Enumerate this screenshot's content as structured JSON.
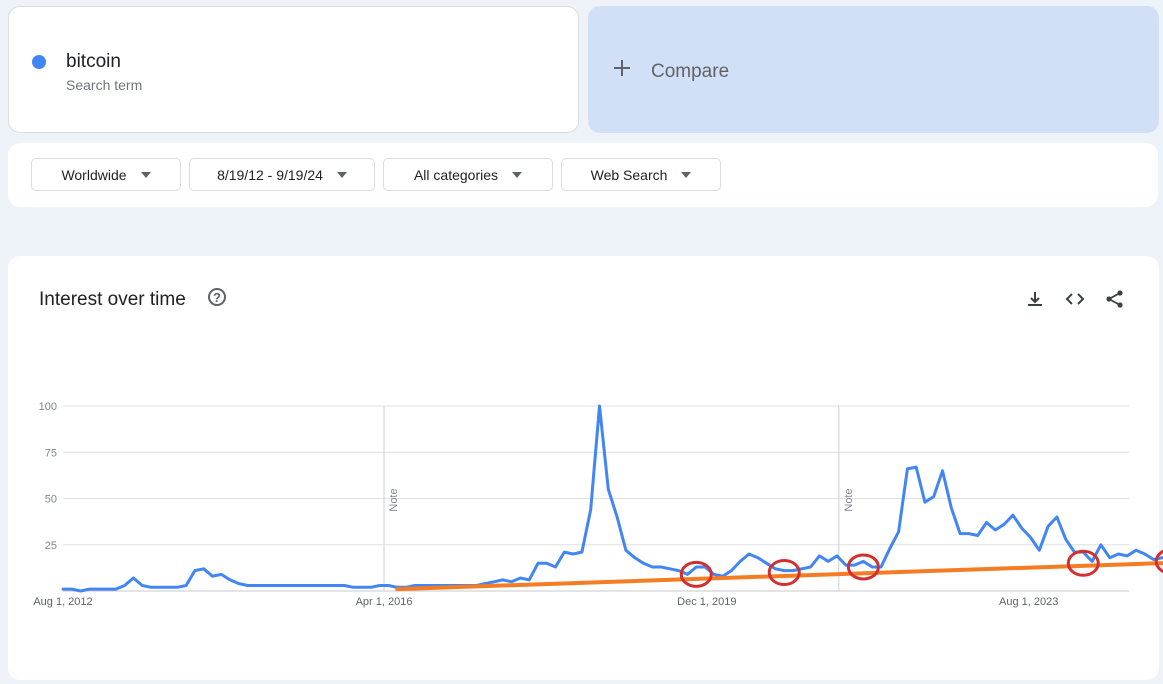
{
  "search_term": {
    "name": "bitcoin",
    "subtitle": "Search term",
    "color": "#4285f4"
  },
  "compare": {
    "label": "Compare",
    "background": "#d2e0f7"
  },
  "filters": [
    {
      "label": "Worldwide"
    },
    {
      "label": "8/19/12 - 9/19/24"
    },
    {
      "label": "All categories"
    },
    {
      "label": "Web Search"
    }
  ],
  "chart_header": {
    "title": "Interest over time",
    "help_icon": "question-circle-icon",
    "tools": [
      "download-icon",
      "embed-code-icon",
      "share-icon"
    ]
  },
  "chart_data": {
    "type": "line",
    "grid": true,
    "y_ticks": [
      "100",
      "75",
      "50",
      "25"
    ],
    "ylim": [
      0,
      100
    ],
    "x_ticks": [
      "Aug 1, 2012",
      "Apr 1, 2016",
      "Dec 1, 2019",
      "Aug 1, 2023"
    ],
    "notes": [
      {
        "label": "Note",
        "at": 2016.25
      },
      {
        "label": "Note",
        "at": 2021.42
      }
    ],
    "xlim": [
      2012.6,
      2024.72
    ],
    "series": [
      {
        "color": "#4285f4",
        "points": [
          [
            2012.6,
            1
          ],
          [
            2012.7,
            1
          ],
          [
            2012.8,
            0
          ],
          [
            2012.9,
            1
          ],
          [
            2013.0,
            1
          ],
          [
            2013.1,
            1
          ],
          [
            2013.2,
            1
          ],
          [
            2013.3,
            3
          ],
          [
            2013.4,
            7
          ],
          [
            2013.5,
            3
          ],
          [
            2013.6,
            2
          ],
          [
            2013.7,
            2
          ],
          [
            2013.8,
            2
          ],
          [
            2013.9,
            2
          ],
          [
            2014.0,
            3
          ],
          [
            2014.1,
            11
          ],
          [
            2014.2,
            12
          ],
          [
            2014.3,
            8
          ],
          [
            2014.4,
            9
          ],
          [
            2014.5,
            6
          ],
          [
            2014.6,
            4
          ],
          [
            2014.7,
            3
          ],
          [
            2014.8,
            3
          ],
          [
            2014.9,
            3
          ],
          [
            2015.0,
            3
          ],
          [
            2015.2,
            3
          ],
          [
            2015.4,
            3
          ],
          [
            2015.6,
            3
          ],
          [
            2015.8,
            3
          ],
          [
            2015.9,
            2
          ],
          [
            2016.0,
            2
          ],
          [
            2016.1,
            2
          ],
          [
            2016.2,
            3
          ],
          [
            2016.3,
            3
          ],
          [
            2016.4,
            2
          ],
          [
            2016.5,
            2
          ],
          [
            2016.6,
            3
          ],
          [
            2016.7,
            3
          ],
          [
            2016.8,
            3
          ],
          [
            2016.9,
            3
          ],
          [
            2017.0,
            3
          ],
          [
            2017.1,
            3
          ],
          [
            2017.2,
            3
          ],
          [
            2017.3,
            3
          ],
          [
            2017.4,
            4
          ],
          [
            2017.5,
            5
          ],
          [
            2017.6,
            6
          ],
          [
            2017.7,
            5
          ],
          [
            2017.8,
            7
          ],
          [
            2017.9,
            6
          ],
          [
            2018.0,
            15
          ],
          [
            2018.1,
            15
          ],
          [
            2018.2,
            13
          ],
          [
            2018.3,
            21
          ],
          [
            2018.4,
            20
          ],
          [
            2018.5,
            21
          ],
          [
            2018.6,
            44
          ],
          [
            2018.7,
            100
          ],
          [
            2018.8,
            55
          ],
          [
            2018.9,
            40
          ],
          [
            2019.0,
            22
          ],
          [
            2019.1,
            18
          ],
          [
            2019.2,
            15
          ],
          [
            2019.3,
            13
          ],
          [
            2019.4,
            13
          ],
          [
            2019.5,
            12
          ],
          [
            2019.6,
            11
          ],
          [
            2019.7,
            9
          ],
          [
            2019.8,
            13
          ],
          [
            2019.9,
            13
          ],
          [
            2020.0,
            9
          ],
          [
            2020.1,
            8
          ],
          [
            2020.2,
            11
          ],
          [
            2020.3,
            16
          ],
          [
            2020.4,
            20
          ],
          [
            2020.5,
            18
          ],
          [
            2020.6,
            15
          ],
          [
            2020.7,
            12
          ],
          [
            2020.8,
            11
          ],
          [
            2020.9,
            11
          ],
          [
            2021.0,
            12
          ],
          [
            2021.1,
            13
          ],
          [
            2021.2,
            19
          ],
          [
            2021.3,
            16
          ],
          [
            2021.4,
            19
          ],
          [
            2021.5,
            14
          ],
          [
            2021.6,
            14
          ],
          [
            2021.7,
            16
          ],
          [
            2021.8,
            13
          ],
          [
            2021.9,
            13
          ],
          [
            2022.0,
            23
          ],
          [
            2022.1,
            32
          ],
          [
            2022.2,
            66
          ],
          [
            2022.3,
            67
          ],
          [
            2022.4,
            48
          ],
          [
            2022.5,
            51
          ],
          [
            2022.6,
            65
          ],
          [
            2022.7,
            45
          ],
          [
            2022.8,
            31
          ],
          [
            2022.9,
            31
          ],
          [
            2023.0,
            30
          ],
          [
            2023.1,
            37
          ],
          [
            2023.2,
            33
          ],
          [
            2023.3,
            36
          ],
          [
            2023.4,
            41
          ],
          [
            2023.5,
            34
          ],
          [
            2023.6,
            29
          ],
          [
            2023.7,
            22
          ],
          [
            2023.8,
            35
          ],
          [
            2023.9,
            40
          ],
          [
            2024.0,
            28
          ],
          [
            2024.1,
            21
          ],
          [
            2024.2,
            21
          ],
          [
            2024.3,
            16
          ],
          [
            2024.4,
            25
          ],
          [
            2024.5,
            18
          ],
          [
            2024.6,
            20
          ],
          [
            2024.7,
            19
          ],
          [
            2024.8,
            22
          ],
          [
            2024.9,
            20
          ],
          [
            2025.0,
            17
          ],
          [
            2025.1,
            18
          ],
          [
            2025.2,
            18
          ],
          [
            2025.3,
            16
          ],
          [
            2025.4,
            15
          ],
          [
            2025.5,
            16
          ],
          [
            2025.6,
            20
          ],
          [
            2025.7,
            24
          ],
          [
            2025.8,
            26
          ],
          [
            2025.9,
            26
          ],
          [
            2026.0,
            41
          ],
          [
            2026.1,
            31
          ],
          [
            2026.2,
            23
          ],
          [
            2026.3,
            19
          ],
          [
            2026.4,
            21
          ],
          [
            2026.5,
            23
          ],
          [
            2026.6,
            24
          ],
          [
            2026.7,
            19
          ]
        ]
      },
      {
        "color": "#f57c23",
        "points": [
          [
            2016.4,
            1
          ],
          [
            2026.9,
            18
          ]
        ]
      }
    ],
    "annotations": [
      {
        "color": "#d32f2f",
        "x": 2019.8,
        "y": 9
      },
      {
        "color": "#d32f2f",
        "x": 2020.8,
        "y": 10
      },
      {
        "color": "#d32f2f",
        "x": 2021.7,
        "y": 13
      },
      {
        "color": "#d32f2f",
        "x": 2024.2,
        "y": 15
      },
      {
        "color": "#d32f2f",
        "x": 2025.2,
        "y": 16
      },
      {
        "color": "#d32f2f",
        "x": 2026.6,
        "y": 18
      }
    ]
  }
}
